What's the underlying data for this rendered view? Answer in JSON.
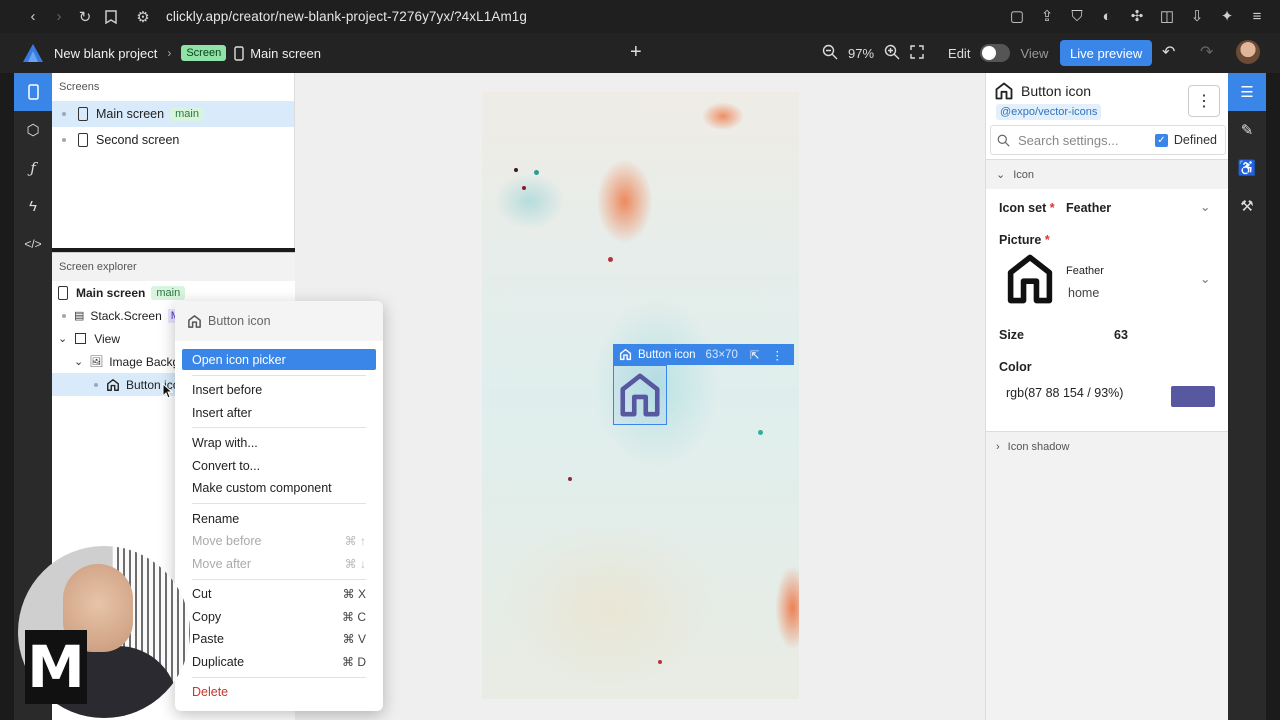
{
  "browser": {
    "url": "clickly.app/creator/new-blank-project-7276y7yx/?4xL1Am1g"
  },
  "appbar": {
    "project_name": "New blank project",
    "screen_badge": "Screen",
    "crumb_screen": "Main screen",
    "zoom": "97%",
    "edit_label": "Edit",
    "view_label": "View",
    "live_preview": "Live preview"
  },
  "screens": {
    "header": "Screens",
    "items": [
      {
        "label": "Main screen",
        "tag": "main"
      },
      {
        "label": "Second screen"
      }
    ]
  },
  "explorer": {
    "header": "Screen explorer",
    "rows": [
      {
        "label": "Main screen",
        "tag": "main"
      },
      {
        "label": "Stack.Screen",
        "tag": "M"
      },
      {
        "label": "View"
      },
      {
        "label": "Image Backgr"
      },
      {
        "label": "Button ico"
      }
    ]
  },
  "canvas": {
    "selection_label": "Button icon",
    "selection_size": "63×70"
  },
  "context_menu": {
    "title": "Button icon",
    "items": [
      {
        "label": "Open icon picker"
      },
      {
        "label": "Insert before"
      },
      {
        "label": "Insert after"
      },
      {
        "label": "Wrap with..."
      },
      {
        "label": "Convert to..."
      },
      {
        "label": "Make custom component"
      },
      {
        "label": "Rename"
      },
      {
        "label": "Move before",
        "shortcut": "⌘ ↑"
      },
      {
        "label": "Move after",
        "shortcut": "⌘ ↓"
      },
      {
        "label": "Cut",
        "shortcut": "⌘ X"
      },
      {
        "label": "Copy",
        "shortcut": "⌘ C"
      },
      {
        "label": "Paste",
        "shortcut": "⌘ V"
      },
      {
        "label": "Duplicate",
        "shortcut": "⌘ D"
      },
      {
        "label": "Delete"
      }
    ]
  },
  "props": {
    "title": "Button icon",
    "package": "@expo/vector-icons",
    "search_placeholder": "Search settings...",
    "defined_label": "Defined",
    "icon_section": "Icon",
    "icon_set_label": "Icon set",
    "icon_set_value": "Feather",
    "picture_label": "Picture",
    "picture_set": "Feather",
    "picture_name": "home",
    "size_label": "Size",
    "size_value": "63",
    "color_label": "Color",
    "color_value": "rgb(87 88 154 / 93%)",
    "color_hex": "#5758a0",
    "shadow_section": "Icon shadow"
  },
  "webcam": {
    "logo_letter": "M"
  },
  "icons": [
    "back-icon",
    "forward-icon",
    "reload-icon",
    "bookmark-icon",
    "site-settings-icon",
    "home-icon",
    "phone-icon",
    "plus-icon",
    "zoom-out-icon",
    "zoom-in-icon",
    "fullscreen-icon",
    "undo-icon",
    "redo-icon",
    "component-icon",
    "function-icon",
    "lightning-icon",
    "code-icon",
    "sliders-icon",
    "brush-icon",
    "accessibility-icon",
    "wrench-icon",
    "chevron-down-icon",
    "chevron-right-icon",
    "search-icon",
    "more-vertical-icon",
    "cursor-icon"
  ]
}
